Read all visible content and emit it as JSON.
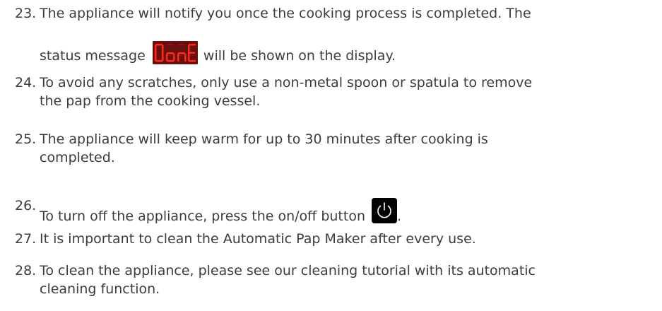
{
  "items": [
    {
      "number": "23.",
      "line1": "The appliance will notify you once the cooking process is completed. The",
      "line2_before": "status message",
      "status_display_text": "DonE",
      "line2_after": "will be shown on the display."
    },
    {
      "number": "24.",
      "line1": "To avoid any scratches, only use a non-metal spoon or spatula to remove",
      "line2": "the pap from the cooking vessel."
    },
    {
      "number": "25.",
      "line1": "The appliance will keep warm for up to 30 minutes after cooking is",
      "line2": "completed."
    },
    {
      "number": "26.",
      "line1_before": "To turn off the appliance, press the on/off button",
      "line1_after": ".",
      "button_icon": "power-icon"
    },
    {
      "number": "27.",
      "line1": "It is important to clean the Automatic Pap Maker after every use."
    },
    {
      "number": "28.",
      "line1": "To clean the appliance, please see our cleaning tutorial with its automatic",
      "line2": "cleaning function."
    }
  ],
  "colors": {
    "text": "#3c3c3c",
    "display_background": "#6a0e0e",
    "display_segments": "#ff2a1a",
    "power_button_background": "#000000",
    "power_icon": "#ffffff"
  }
}
